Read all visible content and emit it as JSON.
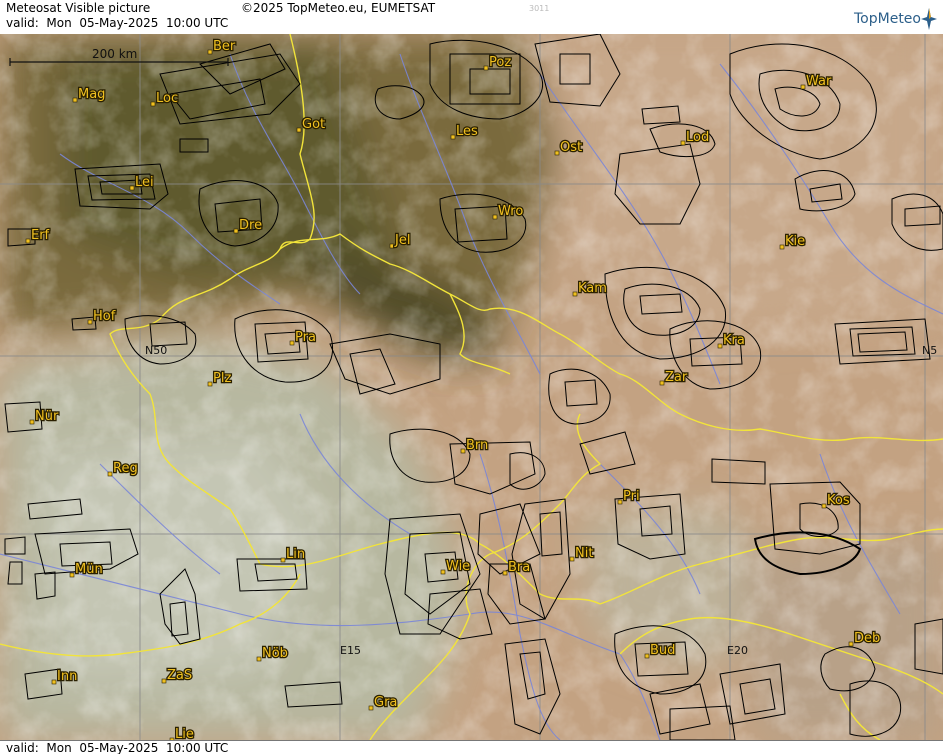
{
  "header": {
    "title": "Meteosat Visible picture",
    "valid": "valid:  Mon  05-May-2025  10:00 UTC",
    "copyright": "©2025 TopMeteo.eu, EUMETSAT",
    "code": "3011",
    "logo": "TopMeteo"
  },
  "footer": {
    "valid": "valid:  Mon  05-May-2025  10:00 UTC"
  },
  "scale_bar": {
    "label": "200 km"
  },
  "grid_labels": [
    "N50",
    "N5",
    "E15",
    "E20"
  ],
  "cities": [
    "Ber",
    "Poz",
    "War",
    "Mag",
    "Loc",
    "Got",
    "Les",
    "Ost",
    "Lod",
    "Lei",
    "Dre",
    "Wro",
    "Erf",
    "Jel",
    "Kie",
    "Kam",
    "Hof",
    "Pra",
    "Kra",
    "Plz",
    "Zar",
    "Nür",
    "Brn",
    "Reg",
    "Pri",
    "Kos",
    "Lin",
    "Nit",
    "Mün",
    "Wie",
    "Bra",
    "Inn",
    "ZaS",
    "Nöb",
    "Bud",
    "Deb",
    "Gra",
    "Lie"
  ],
  "colors": {
    "city": "#f0c020",
    "border": "#f2e43a",
    "river": "#7a86d8",
    "grid": "#8a8a8a",
    "airspace": "#000000"
  }
}
